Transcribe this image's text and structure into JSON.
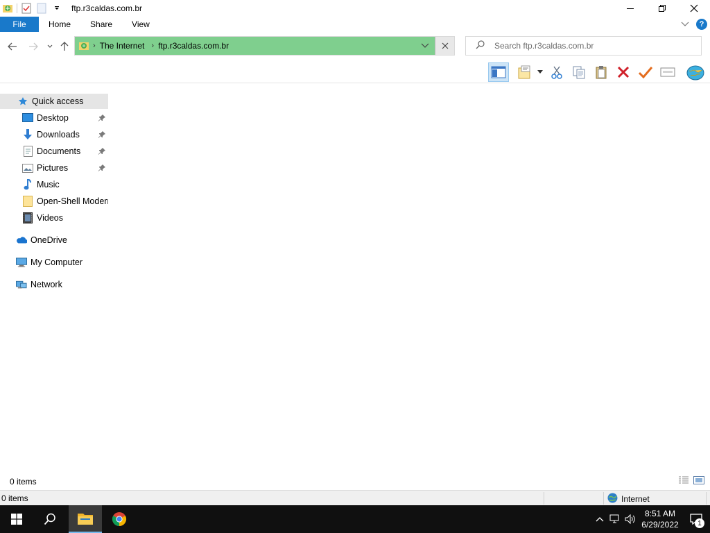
{
  "window": {
    "title": "ftp.r3caldas.com.br",
    "controls": {
      "minimize": "minimize",
      "maximize": "restore",
      "close": "close"
    }
  },
  "ribbon": {
    "tabs": [
      {
        "label": "File",
        "active": true
      },
      {
        "label": "Home"
      },
      {
        "label": "Share"
      },
      {
        "label": "View"
      }
    ],
    "help_label": "?"
  },
  "address_bar": {
    "crumbs": [
      "The Internet",
      "ftp.r3caldas.com.br"
    ],
    "background": "#7fcf8e"
  },
  "search": {
    "placeholder": "Search ftp.r3caldas.com.br"
  },
  "toolbar": {
    "icons": [
      "navigation-pane-icon",
      "properties-icon",
      "cut-icon",
      "copy-icon",
      "paste-icon",
      "delete-icon",
      "checkmark-icon",
      "rename-icon",
      "globe-icon"
    ]
  },
  "navigation": {
    "quick_access": "Quick access",
    "items": [
      {
        "label": "Desktop",
        "pinned": true,
        "icon": "desktop-icon"
      },
      {
        "label": "Downloads",
        "pinned": true,
        "icon": "downloads-icon"
      },
      {
        "label": "Documents",
        "pinned": true,
        "icon": "documents-icon"
      },
      {
        "label": "Pictures",
        "pinned": true,
        "icon": "pictures-icon"
      },
      {
        "label": "Music",
        "pinned": false,
        "icon": "music-icon"
      },
      {
        "label": "Open-Shell Modern",
        "pinned": false,
        "icon": "folder-icon"
      },
      {
        "label": "Videos",
        "pinned": false,
        "icon": "videos-icon"
      }
    ],
    "onedrive": "OneDrive",
    "my_computer": "My Computer",
    "network": "Network"
  },
  "status": {
    "items_count": "0 items",
    "items_count_bottom": "0 items",
    "zone": "Internet"
  },
  "taskbar": {
    "time": "8:51 AM",
    "date": "6/29/2022",
    "notification_count": "1"
  },
  "colors": {
    "accent": "#1979ca",
    "taskbar": "#101010",
    "address_highlight": "#7fcf8e"
  }
}
